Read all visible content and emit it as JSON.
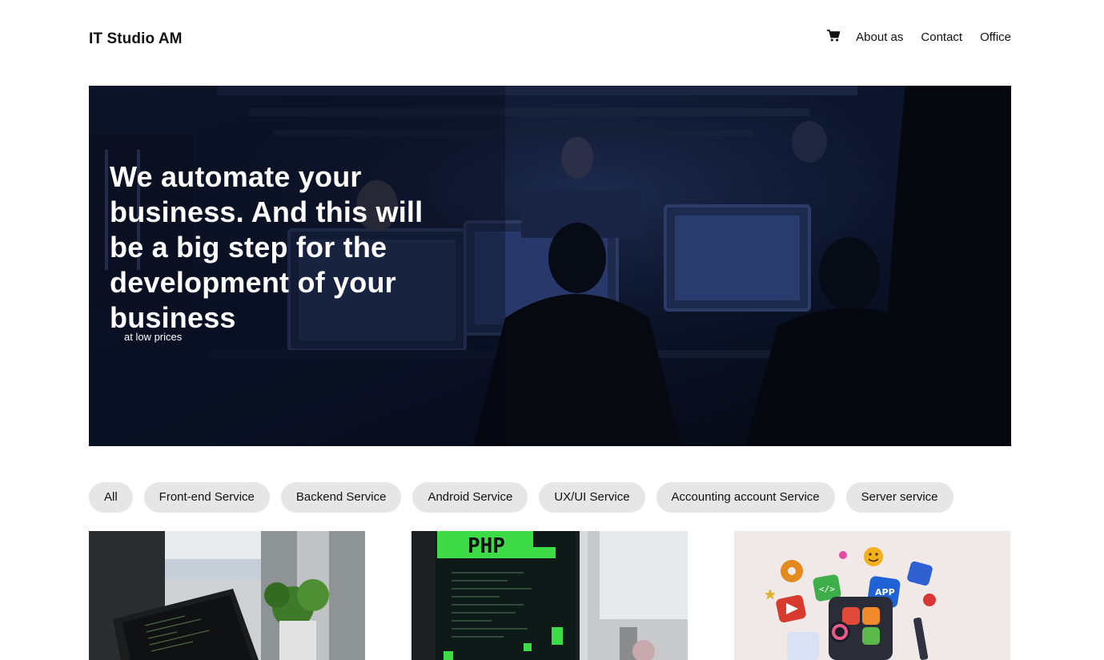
{
  "header": {
    "logo": "IT Studio AM",
    "nav": [
      {
        "label": "About as"
      },
      {
        "label": "Contact"
      },
      {
        "label": "Office"
      }
    ],
    "cart_icon": "cart-icon"
  },
  "hero": {
    "title": "We automate your business. And this will be a big step for the development of your business",
    "subtitle": "at low prices"
  },
  "filters": [
    {
      "label": "All"
    },
    {
      "label": "Front-end Service"
    },
    {
      "label": "Backend Service"
    },
    {
      "label": "Android Service"
    },
    {
      "label": "UX/UI Service"
    },
    {
      "label": "Accounting account Service"
    },
    {
      "label": "Server service"
    }
  ],
  "cards": [
    {
      "image": "laptop-code-image"
    },
    {
      "image": "php-monitor-image",
      "badge": "PHP"
    },
    {
      "image": "app-icons-image",
      "badge": "APP"
    }
  ],
  "colors": {
    "hero_bg": "#0a1226",
    "chip_bg": "#e6e6e6",
    "text": "#111111"
  }
}
